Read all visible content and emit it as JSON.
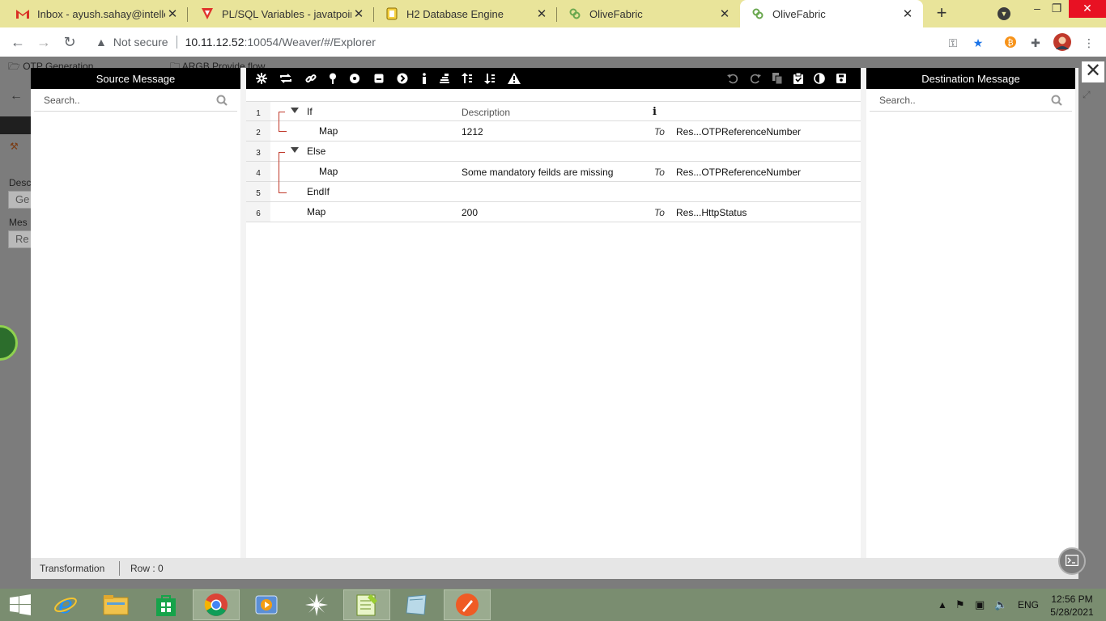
{
  "browser": {
    "tabs": [
      {
        "title": "Inbox - ayush.sahay@intellect",
        "favicon": "gmail-icon"
      },
      {
        "title": "PL/SQL Variables - javatpoint",
        "favicon": "javatpoint-icon"
      },
      {
        "title": "H2 Database Engine",
        "favicon": "h2-icon"
      },
      {
        "title": "OliveFabric",
        "favicon": "olivefabric-icon"
      },
      {
        "title": "OliveFabric",
        "favicon": "olivefabric-icon"
      }
    ],
    "not_secure": "Not secure",
    "url_host": "10.11.12.52",
    "url_rest": ":10054/Weaver/#/Explorer",
    "colors": {
      "tabstrip": "#e9e49a",
      "accent": "#1a73e8"
    }
  },
  "background": {
    "tabs": [
      "OTP Generation",
      "ARGB Provide flow"
    ],
    "labels": [
      "Desc",
      "Mes"
    ],
    "inputs": [
      "Ge",
      "Re"
    ]
  },
  "source": {
    "title": "Source Message",
    "search_placeholder": "Search.."
  },
  "destination": {
    "title": "Destination Message",
    "search_placeholder": "Search.."
  },
  "toolbar_icons": [
    "settings-icon",
    "loop-icon",
    "link-icon",
    "pin-icon",
    "record-icon",
    "box-icon",
    "next-icon",
    "info-icon",
    "stack-icon",
    "sort-asc-icon",
    "sort-desc-icon",
    "warning-icon",
    "undo-icon",
    "redo-icon",
    "copy-icon",
    "paste-icon",
    "contrast-icon",
    "save-icon"
  ],
  "grid": {
    "header_description": "Description",
    "rows": [
      {
        "num": "1",
        "keyword": "If",
        "description": "",
        "to": "",
        "target": ""
      },
      {
        "num": "2",
        "keyword": "Map",
        "description": "1212",
        "to": "To",
        "target": "Res...OTPReferenceNumber"
      },
      {
        "num": "3",
        "keyword": "Else",
        "description": "",
        "to": "",
        "target": ""
      },
      {
        "num": "4",
        "keyword": "Map",
        "description": "Some mandatory feilds are missing",
        "to": "To",
        "target": "Res...OTPReferenceNumber"
      },
      {
        "num": "5",
        "keyword": "EndIf",
        "description": "",
        "to": "",
        "target": ""
      },
      {
        "num": "6",
        "keyword": "Map",
        "description": "200",
        "to": "To",
        "target": "Res...HttpStatus"
      }
    ]
  },
  "status": {
    "mode": "Transformation",
    "row": "Row : 0"
  },
  "taskbar": {
    "lang": "ENG",
    "time": "12:56 PM",
    "date": "5/28/2021"
  }
}
